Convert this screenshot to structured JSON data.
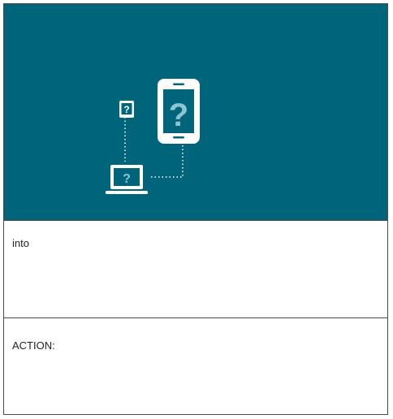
{
  "hero": {
    "background_color": "#00657a",
    "icons": {
      "small_device_glyph": "?",
      "phone_glyph": "?",
      "laptop_glyph": "?"
    }
  },
  "sections": {
    "description": "into",
    "action": "ACTION:"
  }
}
